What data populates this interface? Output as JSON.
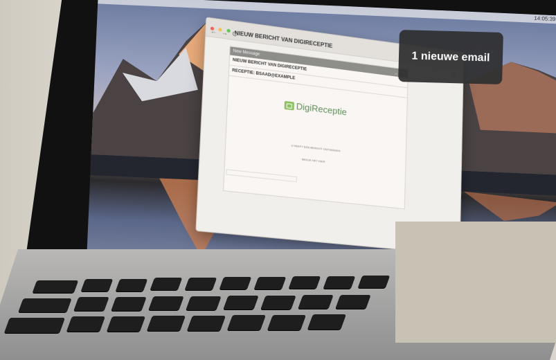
{
  "menubar": {
    "clock": "14:05:39"
  },
  "browser": {
    "title": "NIEUW BERICHT VAN DIGIRECEPTIE",
    "nav": "← → C",
    "menu_icon": "hamburger-icon"
  },
  "message": {
    "window_title": "New Message",
    "window_controls": "_ ↗ ×",
    "line1": "NIEUW BERICHT VAN DIGIRECEPTIE",
    "line2": "RECEPTIE: BSAAD@EXAMPLE",
    "logo_text": "DigiReceptie",
    "logo_sub": "",
    "body_line1": "U HEEFT EEN BERICHT ONTVANGEN",
    "body_line2": "BEKIJK HET HIER",
    "toolbar_hint": "",
    "send_controls": "⎙ ▾"
  },
  "notification": {
    "text": "1 nieuwe email"
  },
  "colors": {
    "logo_green": "#8cc063",
    "notification_bg": "#2f2f30"
  }
}
